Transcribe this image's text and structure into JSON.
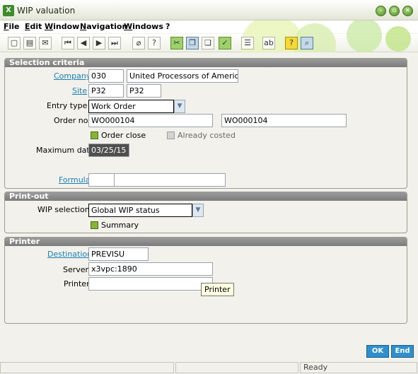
{
  "window": {
    "title": "WIP valuation",
    "icon": "x3-app-icon"
  },
  "menu": [
    "File",
    "Edit",
    "Window",
    "Navigation",
    "Windows",
    "?"
  ],
  "toolbar_icons": [
    "new-icon",
    "print-icon",
    "mail-icon",
    "first-icon",
    "prev-icon",
    "next-icon",
    "last-icon",
    "attach-icon",
    "help-icon",
    "select-icon",
    "copy-icon",
    "paste-icon",
    "validate-icon",
    "report-icon",
    "text-icon",
    "help2-icon",
    "search-icon"
  ],
  "selection": {
    "header": "Selection criteria",
    "company_label": "Company",
    "company_code": "030",
    "company_name": "United Processors of America",
    "site_label": "Site",
    "site_code": "P32",
    "site_name": "P32",
    "entry_type_label": "Entry type",
    "entry_type": "Work Order",
    "order_no_label": "Order no.",
    "order_from": "WO000104",
    "order_to": "WO000104",
    "order_close_label": "Order close",
    "already_costed_label": "Already costed",
    "max_date_label": "Maximum date",
    "max_date": "03/25/15",
    "formula_label": "Formula",
    "formula_code": "",
    "formula_desc": ""
  },
  "printout": {
    "header": "Print-out",
    "wip_selection_label": "WIP selection",
    "wip_selection": "Global WIP status",
    "summary_label": "Summary"
  },
  "printer": {
    "header": "Printer",
    "destination_label": "Destination",
    "destination": "PREVISU",
    "server_label": "Server",
    "server": "x3vpc:1890",
    "printer_label": "Printer",
    "printer": "",
    "tooltip": "Printer"
  },
  "buttons": {
    "ok": "OK",
    "end": "End"
  },
  "status": {
    "text": "Ready"
  }
}
